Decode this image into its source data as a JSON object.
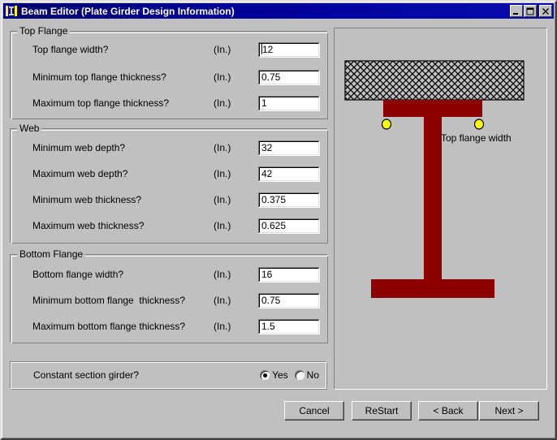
{
  "window": {
    "title": "Beam Editor (Plate Girder Design Information)",
    "icon": "beam-editor-icon",
    "controls": {
      "minimize": "minimize-icon",
      "maximize": "maximize-icon",
      "close": "close-icon"
    }
  },
  "groups": [
    {
      "title": "Top Flange",
      "rows": [
        {
          "label": "Top flange width?",
          "unit": "(In.)",
          "value": "12",
          "focused": true
        },
        {
          "label": "Minimum top flange thickness?",
          "unit": "(In.)",
          "value": "0.75",
          "focused": false
        },
        {
          "label": "Maximum top flange thickness?",
          "unit": "(In.)",
          "value": "1",
          "focused": false
        }
      ]
    },
    {
      "title": "Web",
      "rows": [
        {
          "label": "Minimum web depth?",
          "unit": "(In.)",
          "value": "32",
          "focused": false
        },
        {
          "label": "Maximum web depth?",
          "unit": "(In.)",
          "value": "42",
          "focused": false
        },
        {
          "label": "Minimum web thickness?",
          "unit": "(In.)",
          "value": "0.375",
          "focused": false
        },
        {
          "label": "Maximum web thickness?",
          "unit": "(In.)",
          "value": "0.625",
          "focused": false
        }
      ]
    },
    {
      "title": "Bottom Flange",
      "rows": [
        {
          "label": "Bottom flange width?",
          "unit": "(In.)",
          "value": "16",
          "focused": false
        },
        {
          "label": "Minimum bottom flange  thickness?",
          "unit": "(In.)",
          "value": "0.75",
          "focused": false
        },
        {
          "label": "Maximum bottom flange thickness?",
          "unit": "(In.)",
          "value": "1.5",
          "focused": false
        }
      ]
    }
  ],
  "constant_section": {
    "label": "Constant section girder?",
    "options": [
      {
        "label": "Yes",
        "selected": true
      },
      {
        "label": "No",
        "selected": false
      }
    ]
  },
  "diagram": {
    "annotation": "Top flange width",
    "colors": {
      "steel": "#8b0000",
      "marker": "#ffff00",
      "slab_fill": "#c0c0c0",
      "slab_hatch": "#000000",
      "panel_bg": "#c0c0c0"
    },
    "parts": {
      "deck_slab": "concrete-deck-slab",
      "top_flange": "top-flange",
      "web": "web",
      "bottom_flange": "bottom-flange",
      "marker_left": "flange-edge-marker-left",
      "marker_right": "flange-edge-marker-right"
    }
  },
  "buttons": {
    "cancel": "Cancel",
    "restart": "ReStart",
    "back": "< Back",
    "next": "Next >"
  }
}
